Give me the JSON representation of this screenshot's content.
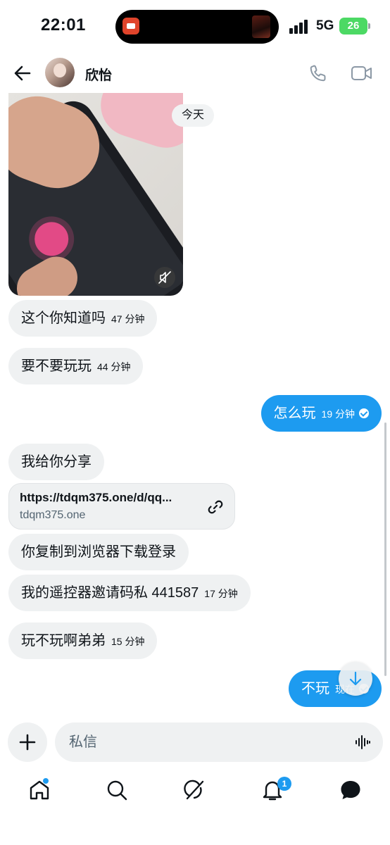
{
  "status_bar": {
    "time": "22:01",
    "network": "5G",
    "battery": "26"
  },
  "header": {
    "contact_name": "欣怡"
  },
  "date_chip": "今天",
  "messages": [
    {
      "text": "这个你知道吗",
      "time": "47 分钟"
    },
    {
      "text": "要不要玩玩",
      "time": "44 分钟"
    },
    {
      "text": "怎么玩",
      "time": "19 分钟"
    },
    {
      "text": "我给你分享",
      "time": ""
    },
    {
      "text": "你复制到浏览器下载登录",
      "time": ""
    },
    {
      "text": "我的遥控器邀请码私 441587",
      "time": "17 分钟"
    },
    {
      "text": "玩不玩啊弟弟",
      "time": "15 分钟"
    },
    {
      "text": "不玩",
      "time": "现在"
    }
  ],
  "link_card": {
    "url": "https://tdqm375.one/d/qq...",
    "domain": "tdqm375.one"
  },
  "composer": {
    "placeholder": "私信"
  },
  "tab_bar": {
    "notifications_badge": "1"
  },
  "colors": {
    "accent": "#1d9bf0",
    "incoming_bubble": "#eff1f2",
    "battery": "#4cd964"
  },
  "icons": [
    "back-arrow-icon",
    "phone-icon",
    "video-icon",
    "mute-icon",
    "link-icon",
    "arrow-down-icon",
    "plus-icon",
    "voice-icon",
    "home-icon",
    "search-icon",
    "grok-icon",
    "bell-icon",
    "messages-icon"
  ]
}
